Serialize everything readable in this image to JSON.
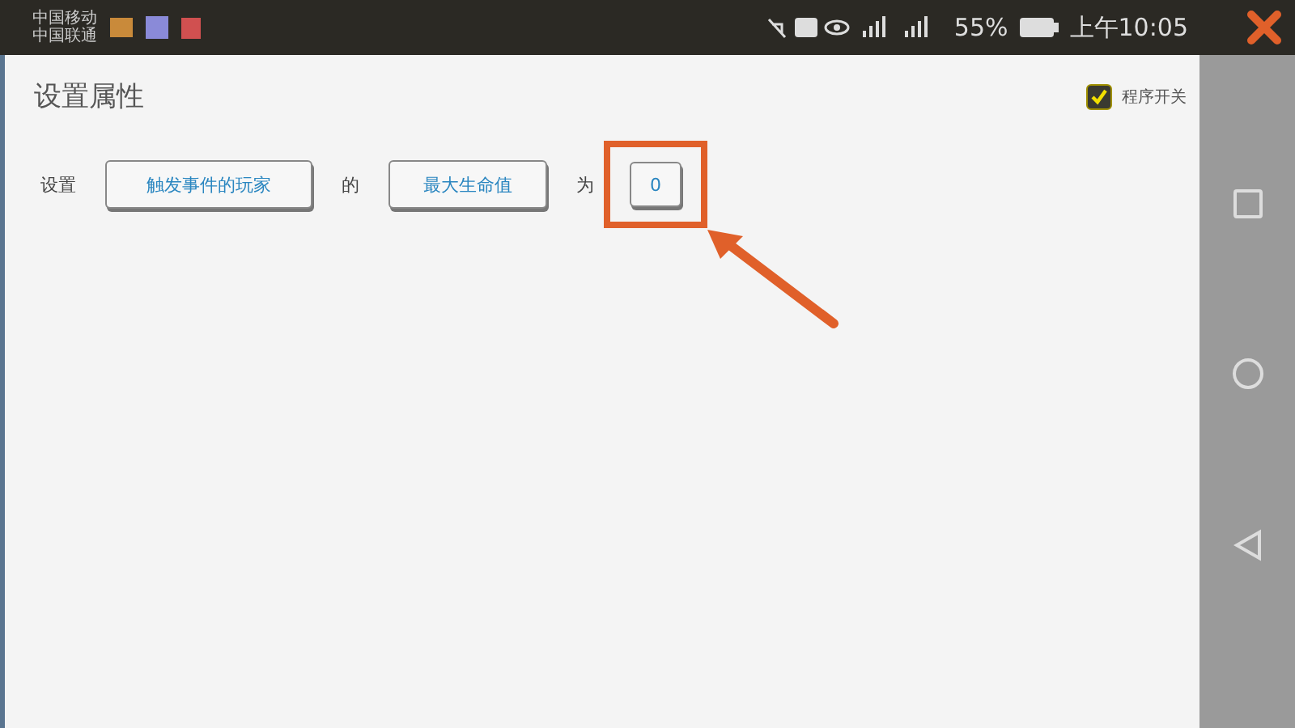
{
  "status_bar": {
    "carriers": [
      "中国移动",
      "中国联通"
    ],
    "battery": "55%",
    "time": "上午10:05"
  },
  "dialog": {
    "title": "设置属性",
    "toggle": {
      "label": "程序开关",
      "checked": true
    },
    "statement": [
      {
        "kind": "text",
        "text": "设置"
      },
      {
        "kind": "button",
        "text": "触发事件的玩家"
      },
      {
        "kind": "text",
        "text": "的"
      },
      {
        "kind": "button",
        "text": "最大生命值"
      },
      {
        "kind": "text",
        "text": "为"
      },
      {
        "kind": "value",
        "text": "0",
        "highlighted": true
      }
    ]
  }
}
